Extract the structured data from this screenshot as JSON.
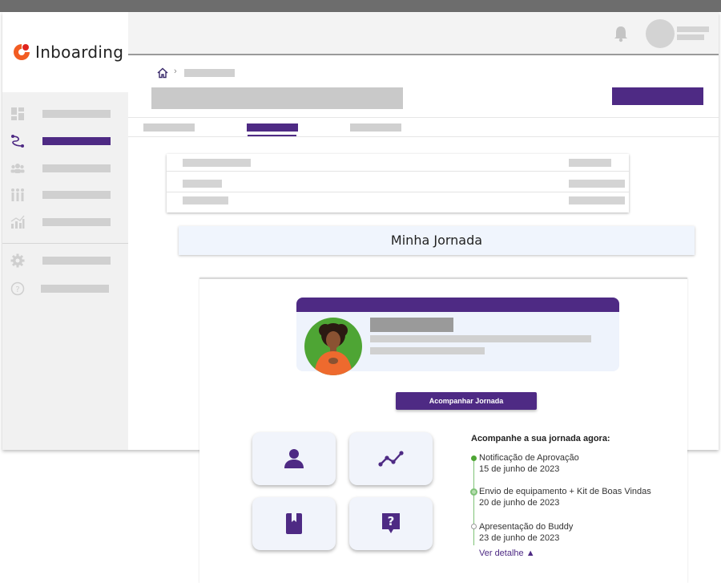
{
  "app": {
    "brand_name": "Inboarding",
    "brand_colors": {
      "logo_orange": "#f25c22",
      "logo_red": "#e0241e",
      "primary": "#4e2a84",
      "success": "#4ea534"
    }
  },
  "sidebar": {
    "items": [
      {
        "icon": "dashboard-icon",
        "active": false
      },
      {
        "icon": "journey-icon",
        "active": true
      },
      {
        "icon": "team-icon",
        "active": false
      },
      {
        "icon": "people-icon",
        "active": false
      },
      {
        "icon": "analytics-icon",
        "active": false
      },
      {
        "icon": "gear-icon",
        "active": false
      },
      {
        "icon": "help-icon",
        "active": false
      }
    ]
  },
  "header": {
    "icons": [
      "bell-icon",
      "avatar"
    ]
  },
  "breadcrumb": {
    "home_icon": "home-icon",
    "separator": "›"
  },
  "journey": {
    "section_title": "Minha Jornada",
    "track_button_label": "Acompanhar Jornada",
    "tiles": [
      "profile-icon",
      "progress-chart-icon",
      "book-icon",
      "help-bubble-icon"
    ],
    "timeline": {
      "title": "Acompanhe a sua jornada agora:",
      "steps": [
        {
          "label": "Notificação de Aprovação",
          "date": "15 de junho de 2023",
          "status": "done"
        },
        {
          "label": "Envio de equipamento + Kit de Boas Vindas",
          "date": "20 de junho de 2023",
          "status": "current"
        },
        {
          "label": "Apresentação do Buddy",
          "date": "23 de junho de 2023",
          "status": "pending"
        }
      ],
      "details_link": "Ver detalhe ▲"
    }
  }
}
